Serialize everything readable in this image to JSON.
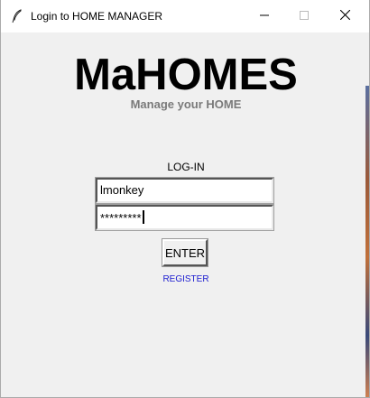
{
  "window": {
    "title": "Login to HOME MANAGER",
    "app_icon": "feather-icon",
    "controls": {
      "minimize": "minimize-icon",
      "maximize": "maximize-icon",
      "close": "close-icon"
    }
  },
  "header": {
    "logo": "MaHOMES",
    "tagline": "Manage your HOME"
  },
  "login": {
    "heading": "LOG-IN",
    "username_value": "lmonkey",
    "password_value": "*********",
    "enter_label": "ENTER",
    "register_label": "REGISTER"
  },
  "colors": {
    "background": "#f0f0f0",
    "tagline": "#7a7a7a",
    "link": "#1c1cd0"
  }
}
